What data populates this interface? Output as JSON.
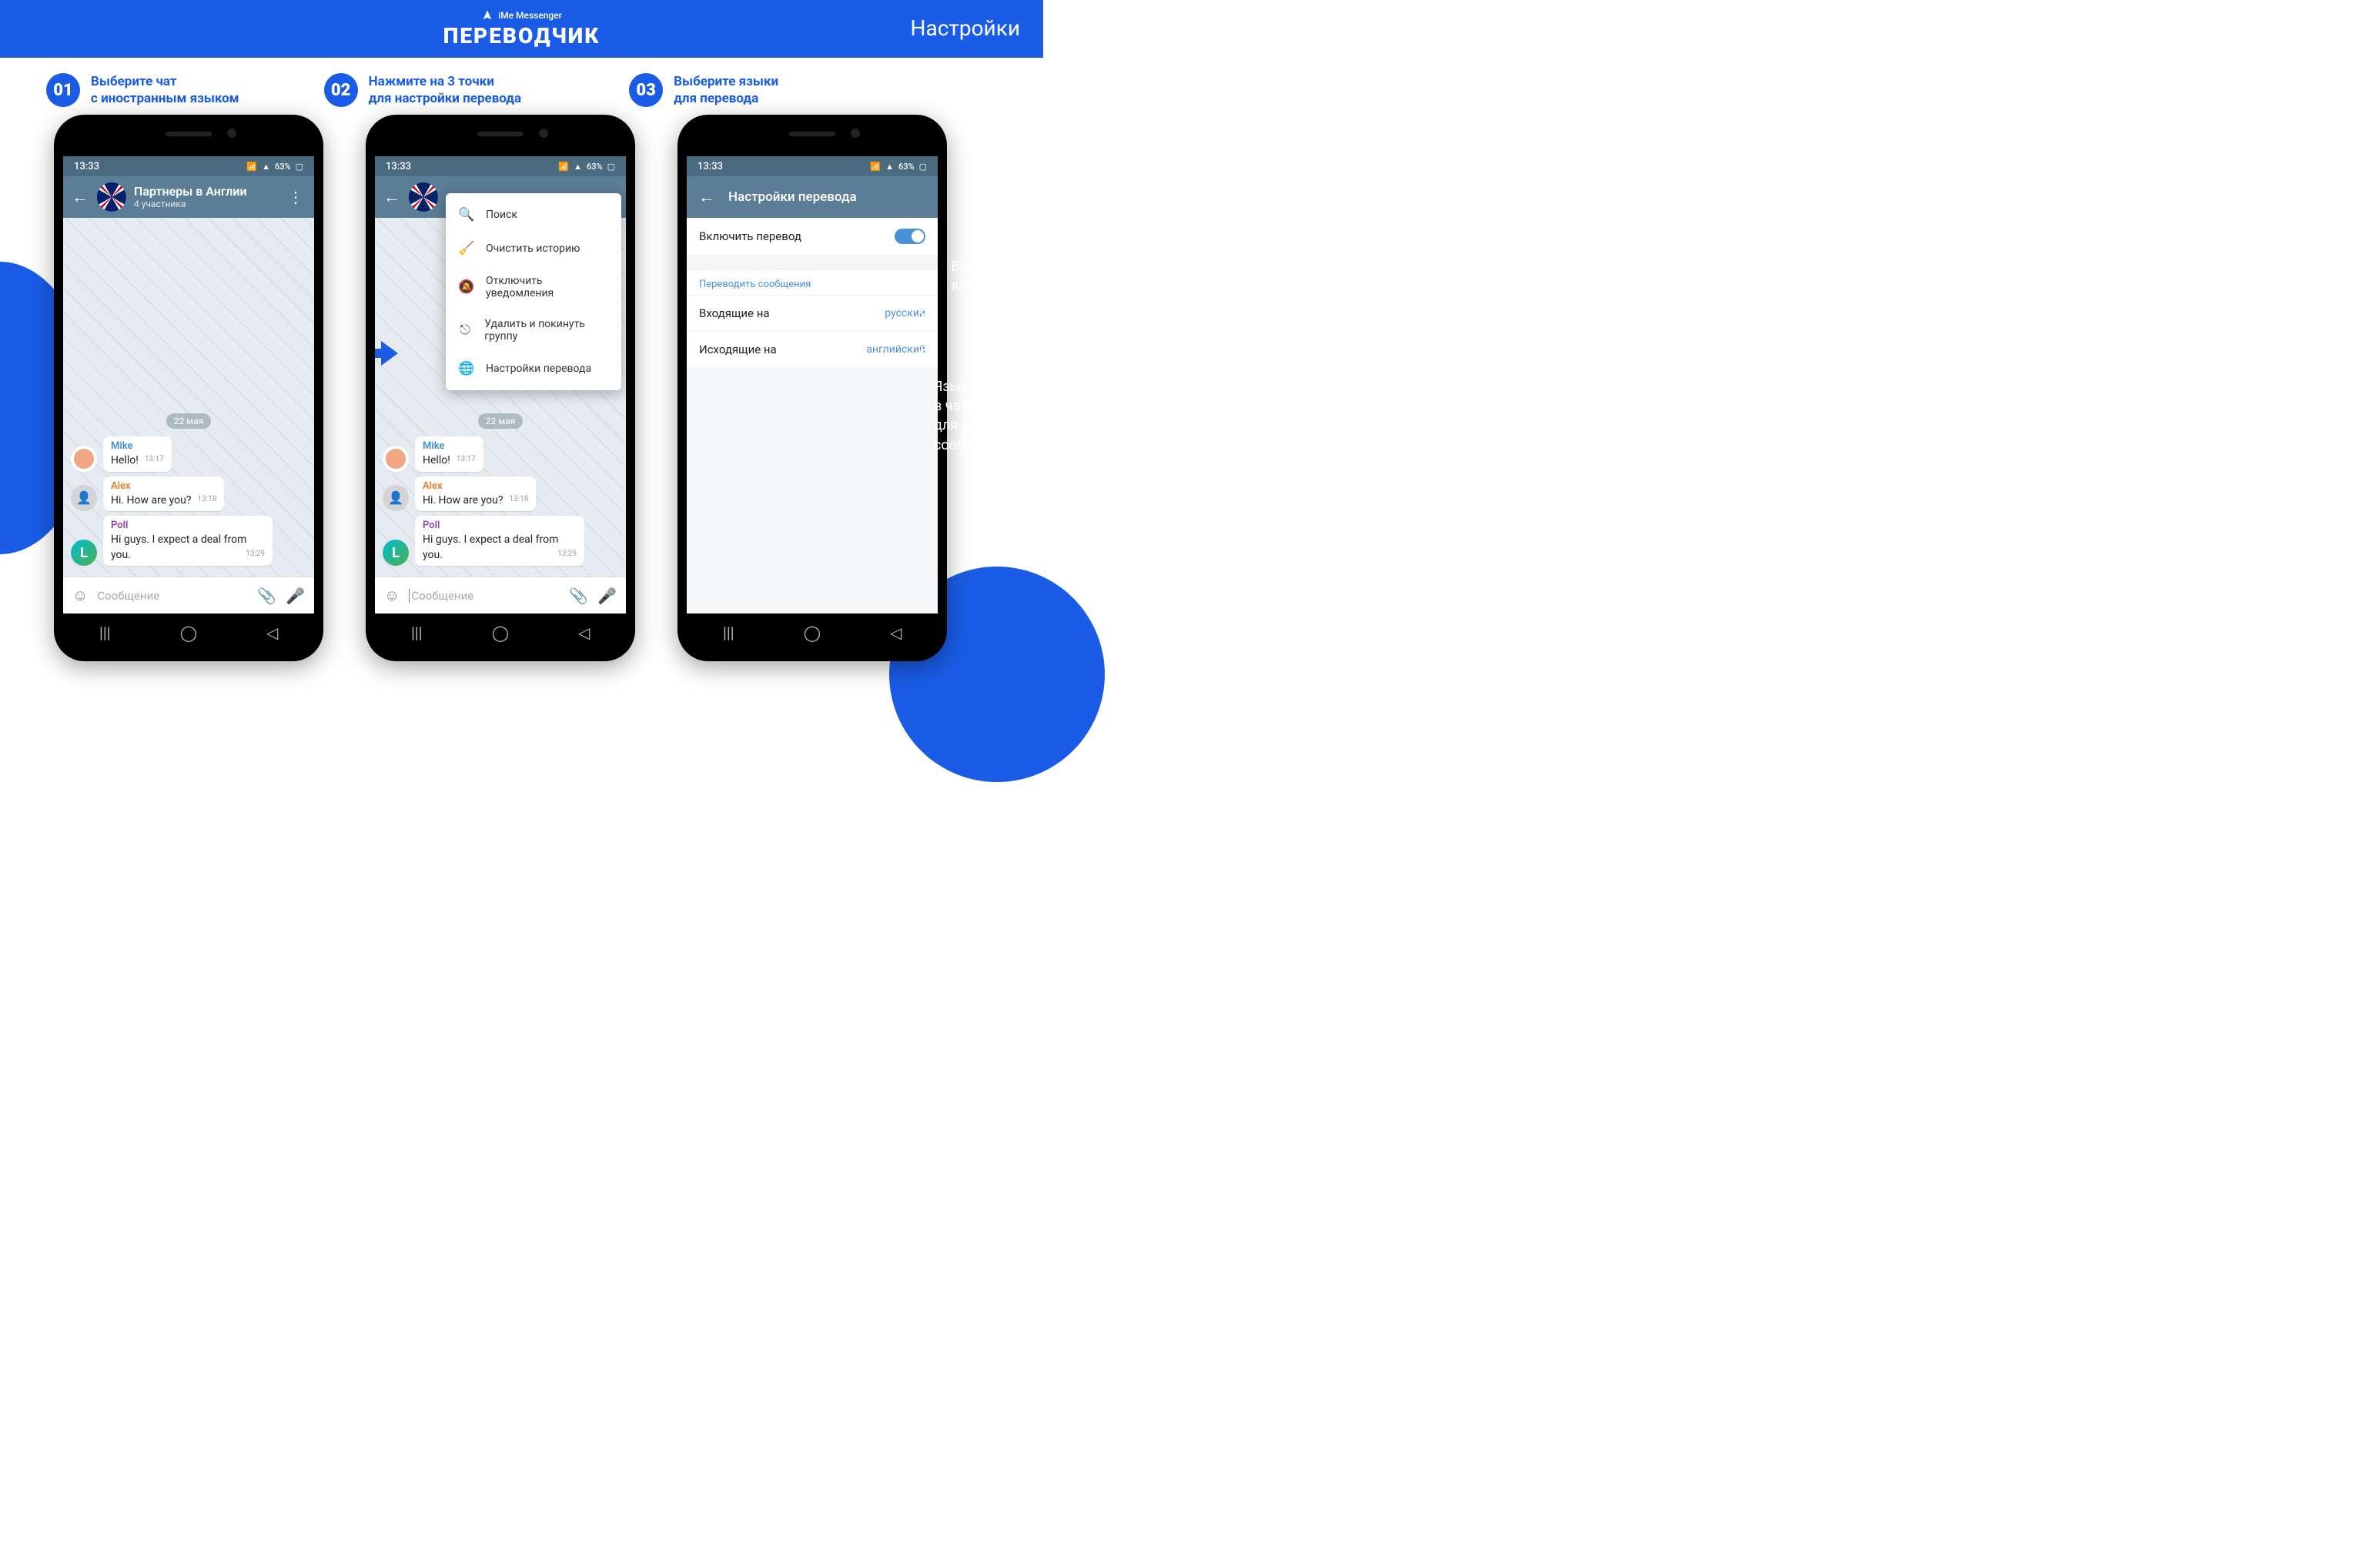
{
  "banner": {
    "brand": "iMe Messenger",
    "title": "ПЕРЕВОДЧИК",
    "settings": "Настройки"
  },
  "steps": [
    {
      "num": "01",
      "line1": "Выберите чат",
      "line2": "с иностранным языком"
    },
    {
      "num": "02",
      "line1": "Нажмите на 3 точки",
      "line2": "для настройки перевода"
    },
    {
      "num": "03",
      "line1": "Выберите языки",
      "line2": "для перевода"
    }
  ],
  "status": {
    "time": "13:33",
    "battery": "63%"
  },
  "chat": {
    "title": "Партнеры в Англии",
    "subtitle": "4 участника",
    "date": "22 мая",
    "placeholder": "Сообщение",
    "msgs": [
      {
        "sender": "Mike",
        "text": "Hello!",
        "time": "13:17",
        "cls": "mike"
      },
      {
        "sender": "Alex",
        "text": "Hi. How are you?",
        "time": "13:18",
        "cls": "alex"
      },
      {
        "sender": "Poll",
        "text": "Hi guys. I expect a deal from you.",
        "time": "13:29",
        "cls": "poll"
      }
    ]
  },
  "menu": [
    {
      "icon": "search",
      "label": "Поиск"
    },
    {
      "icon": "broom",
      "label": "Очистить историю"
    },
    {
      "icon": "mute",
      "label": "Отключить уведомления"
    },
    {
      "icon": "leave",
      "label": "Удалить и покинуть группу"
    },
    {
      "icon": "translate",
      "label": "Настройки перевода"
    }
  ],
  "settings": {
    "title": "Настройки перевода",
    "enable": "Включить перевод",
    "section": "Переводить сообщения",
    "incoming_label": "Входящие на",
    "incoming_val": "русский",
    "outgoing_label": "Исходящие на",
    "outgoing_val": "английский"
  },
  "annot": {
    "top1": "Ваш родной",
    "top2": "язык",
    "bot1": "Язык общения",
    "bot2": "в чате,",
    "bot3": "для ваших",
    "bot4": "сообщений"
  }
}
